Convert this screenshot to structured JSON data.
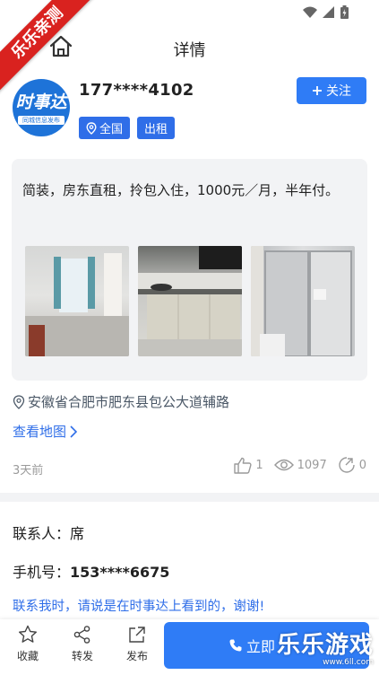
{
  "watermark": {
    "corner": "乐乐亲测",
    "brand": "乐乐游戏",
    "url": "www.6ll.com"
  },
  "header": {
    "title": "详情"
  },
  "profile": {
    "avatar_title": "时事达",
    "avatar_subtitle": "同城信息发布",
    "phone_masked": "177****4102",
    "tags": [
      "全国",
      "出租"
    ],
    "follow_label": "关注"
  },
  "post": {
    "description": "简装，房东直租，拎包入住，1000元／月，半年付。",
    "photos": [
      "living-room",
      "kitchen",
      "bathroom"
    ],
    "location": "安徽省合肥市肥东县包公大道辅路",
    "map_link": "查看地图",
    "time_ago": "3天前",
    "likes": "1",
    "views": "1097",
    "shares": "0"
  },
  "contact": {
    "name_label": "联系人：",
    "name": "席",
    "phone_label": "手机号：",
    "phone": "153****6675",
    "notice": "联系我时，请说是在时事达上看到的，谢谢!"
  },
  "bottom_bar": {
    "favorite_label": "收藏",
    "forward_label": "转发",
    "publish_label": "发布",
    "call_label": "立即"
  },
  "colors": {
    "accent": "#2f7cf6",
    "ribbon": "#d9221f",
    "card_bg": "#f2f3f5"
  }
}
